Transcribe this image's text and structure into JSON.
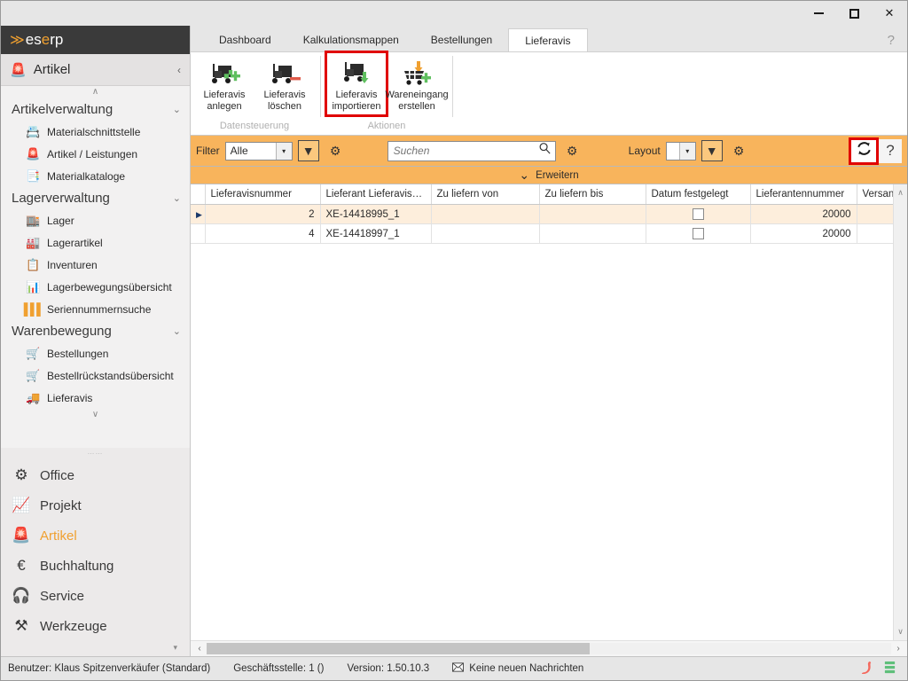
{
  "window": {
    "minimize_label": "Minimieren",
    "maximize_label": "Maximieren",
    "close_label": "✕"
  },
  "sidebar": {
    "brand": {
      "logo": "≫",
      "text_1": "es",
      "text_2": "e",
      "text_3": "rp",
      "full": "eserp"
    },
    "module_header": {
      "icon": "🚨",
      "label": "Artikel",
      "collapse_chevron": "‹"
    },
    "scroll_up": "∧",
    "scroll_down": "∨",
    "groups": [
      {
        "title": "Artikelverwaltung",
        "chevron": "⌄",
        "items": [
          {
            "label": "Materialschnittstelle",
            "icon": "📇"
          },
          {
            "label": "Artikel / Leistungen",
            "icon": "🚨"
          },
          {
            "label": "Materialkataloge",
            "icon": "📑"
          }
        ]
      },
      {
        "title": "Lagerverwaltung",
        "chevron": "⌄",
        "items": [
          {
            "label": "Lager",
            "icon": "🏬"
          },
          {
            "label": "Lagerartikel",
            "icon": "🏭"
          },
          {
            "label": "Inventuren",
            "icon": "📋"
          },
          {
            "label": "Lagerbewegungsübersicht",
            "icon": "📊"
          },
          {
            "label": "Seriennummernsuche",
            "icon": "▐▐▐"
          }
        ]
      },
      {
        "title": "Warenbewegung",
        "chevron": "⌄",
        "items": [
          {
            "label": "Bestellungen",
            "icon": "🛒"
          },
          {
            "label": "Bestellrückstandsübersicht",
            "icon": "🛒"
          },
          {
            "label": "Lieferavis",
            "icon": "🚚"
          }
        ]
      }
    ],
    "modules": [
      {
        "label": "Office",
        "icon": "⚙",
        "active": false
      },
      {
        "label": "Projekt",
        "icon": "📈",
        "active": false
      },
      {
        "label": "Artikel",
        "icon": "🚨",
        "active": true
      },
      {
        "label": "Buchhaltung",
        "icon": "€",
        "active": false
      },
      {
        "label": "Service",
        "icon": "🎧",
        "active": false
      },
      {
        "label": "Werkzeuge",
        "icon": "⚒",
        "active": false
      }
    ],
    "modules_more": "▾"
  },
  "tabs": {
    "items": [
      {
        "label": "Dashboard",
        "active": false
      },
      {
        "label": "Kalkulationsmappen",
        "active": false
      },
      {
        "label": "Bestellungen",
        "active": false
      },
      {
        "label": "Lieferavis",
        "active": true
      }
    ],
    "help": "?"
  },
  "ribbon": {
    "groups": [
      {
        "label": "Datensteuerung",
        "buttons": [
          {
            "line1": "Lieferavis",
            "line2": "anlegen",
            "icon": "truck-plus-icon",
            "highlighted": false
          },
          {
            "line1": "Lieferavis",
            "line2": "löschen",
            "icon": "truck-delete-icon",
            "highlighted": false
          }
        ]
      },
      {
        "label": "Aktionen",
        "buttons": [
          {
            "line1": "Lieferavis",
            "line2": "importieren",
            "icon": "truck-import-icon",
            "highlighted": true
          },
          {
            "line1": "Wareneingang",
            "line2": "erstellen",
            "icon": "cart-plus-icon",
            "highlighted": false
          }
        ]
      }
    ]
  },
  "toolbar": {
    "filter_label": "Filter",
    "filter_value": "Alle",
    "filter_caret": "▾",
    "filter_funnel_icon": "▼",
    "filter_gear_icon": "⚙",
    "search_placeholder": "Suchen",
    "search_value": "",
    "search_icon": "🔍",
    "search_gear_icon": "⚙",
    "layout_label": "Layout",
    "layout_value": "",
    "layout_caret": "▾",
    "layout_funnel_icon": "▼",
    "layout_gear_icon": "⚙",
    "refresh_icon": "⟳",
    "help_icon": "?",
    "refresh_highlighted": true
  },
  "expander": {
    "chevron": "⌄",
    "label": "Erweitern"
  },
  "grid": {
    "columns": [
      "Lieferavisnummer",
      "Lieferant Lieferavisn...",
      "Zu liefern von",
      "Zu liefern bis",
      "Datum festgelegt",
      "Lieferantennummer",
      "Versand"
    ],
    "rows": [
      {
        "selected": true,
        "marker": "▶",
        "lieferavisnummer": "2",
        "lieferant_lieferavisnummer": "XE-14418995_1",
        "zu_liefern_von": "",
        "zu_liefern_bis": "",
        "datum_festgelegt": false,
        "lieferantennummer": "20000",
        "versand": ""
      },
      {
        "selected": false,
        "marker": "",
        "lieferavisnummer": "4",
        "lieferant_lieferavisnummer": "XE-14418997_1",
        "zu_liefern_von": "",
        "zu_liefern_bis": "",
        "datum_festgelegt": false,
        "lieferantennummer": "20000",
        "versand": ""
      }
    ],
    "vscroll_up": "∧",
    "vscroll_down": "∨",
    "hscroll_left": "‹",
    "hscroll_right": "›"
  },
  "statusbar": {
    "user": "Benutzer: Klaus Spitzenverkäufer (Standard)",
    "branch": "Geschäftsstelle: 1 ()",
    "version": "Version: 1.50.10.3",
    "messages_icon": "✉",
    "messages": "Keine neuen Nachrichten",
    "phone_icon": "📞",
    "db_icon": "☰"
  },
  "colors": {
    "accent_orange": "#f8b45c",
    "brand_orange": "#f0a030",
    "highlight_red": "#e00000",
    "selected_row": "#fdeedc",
    "sidebar_bg": "#eceaea",
    "titlebar_bg": "#e6e6e6"
  }
}
